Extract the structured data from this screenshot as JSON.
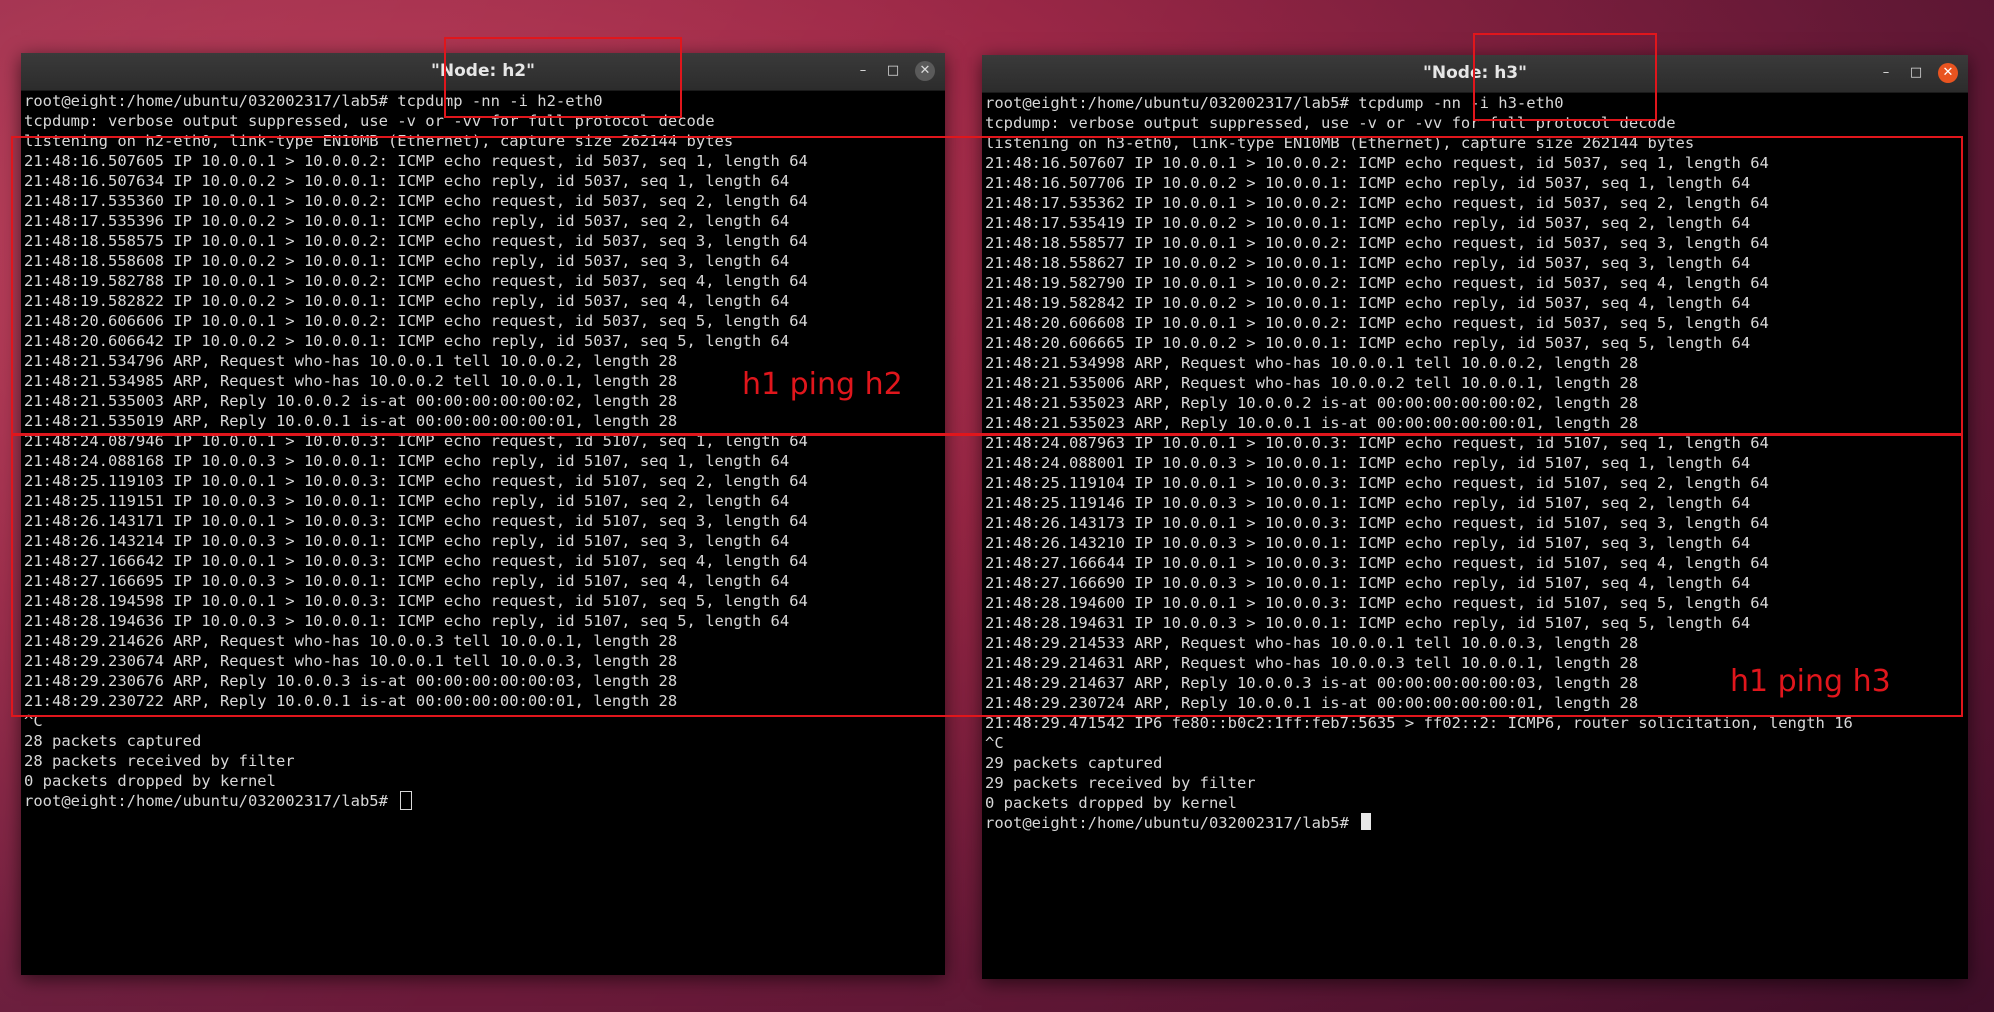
{
  "left_window": {
    "title": "\"Node: h2\"",
    "min_icon": "minimize-icon",
    "max_icon": "maximize-icon",
    "close_icon": "close-icon",
    "lines": [
      "root@eight:/home/ubuntu/032002317/lab5# tcpdump -nn -i h2-eth0",
      "tcpdump: verbose output suppressed, use -v or -vv for full protocol decode",
      "listening on h2-eth0, link-type EN10MB (Ethernet), capture size 262144 bytes",
      "21:48:16.507605 IP 10.0.0.1 > 10.0.0.2: ICMP echo request, id 5037, seq 1, length 64",
      "21:48:16.507634 IP 10.0.0.2 > 10.0.0.1: ICMP echo reply, id 5037, seq 1, length 64",
      "21:48:17.535360 IP 10.0.0.1 > 10.0.0.2: ICMP echo request, id 5037, seq 2, length 64",
      "21:48:17.535396 IP 10.0.0.2 > 10.0.0.1: ICMP echo reply, id 5037, seq 2, length 64",
      "21:48:18.558575 IP 10.0.0.1 > 10.0.0.2: ICMP echo request, id 5037, seq 3, length 64",
      "21:48:18.558608 IP 10.0.0.2 > 10.0.0.1: ICMP echo reply, id 5037, seq 3, length 64",
      "21:48:19.582788 IP 10.0.0.1 > 10.0.0.2: ICMP echo request, id 5037, seq 4, length 64",
      "21:48:19.582822 IP 10.0.0.2 > 10.0.0.1: ICMP echo reply, id 5037, seq 4, length 64",
      "21:48:20.606606 IP 10.0.0.1 > 10.0.0.2: ICMP echo request, id 5037, seq 5, length 64",
      "21:48:20.606642 IP 10.0.0.2 > 10.0.0.1: ICMP echo reply, id 5037, seq 5, length 64",
      "21:48:21.534796 ARP, Request who-has 10.0.0.1 tell 10.0.0.2, length 28",
      "21:48:21.534985 ARP, Request who-has 10.0.0.2 tell 10.0.0.1, length 28",
      "21:48:21.535003 ARP, Reply 10.0.0.2 is-at 00:00:00:00:00:02, length 28",
      "21:48:21.535019 ARP, Reply 10.0.0.1 is-at 00:00:00:00:00:01, length 28",
      "21:48:24.087946 IP 10.0.0.1 > 10.0.0.3: ICMP echo request, id 5107, seq 1, length 64",
      "21:48:24.088168 IP 10.0.0.3 > 10.0.0.1: ICMP echo reply, id 5107, seq 1, length 64",
      "21:48:25.119103 IP 10.0.0.1 > 10.0.0.3: ICMP echo request, id 5107, seq 2, length 64",
      "21:48:25.119151 IP 10.0.0.3 > 10.0.0.1: ICMP echo reply, id 5107, seq 2, length 64",
      "21:48:26.143171 IP 10.0.0.1 > 10.0.0.3: ICMP echo request, id 5107, seq 3, length 64",
      "21:48:26.143214 IP 10.0.0.3 > 10.0.0.1: ICMP echo reply, id 5107, seq 3, length 64",
      "21:48:27.166642 IP 10.0.0.1 > 10.0.0.3: ICMP echo request, id 5107, seq 4, length 64",
      "21:48:27.166695 IP 10.0.0.3 > 10.0.0.1: ICMP echo reply, id 5107, seq 4, length 64",
      "21:48:28.194598 IP 10.0.0.1 > 10.0.0.3: ICMP echo request, id 5107, seq 5, length 64",
      "21:48:28.194636 IP 10.0.0.3 > 10.0.0.1: ICMP echo reply, id 5107, seq 5, length 64",
      "21:48:29.214626 ARP, Request who-has 10.0.0.3 tell 10.0.0.1, length 28",
      "21:48:29.230674 ARP, Request who-has 10.0.0.1 tell 10.0.0.3, length 28",
      "21:48:29.230676 ARP, Reply 10.0.0.3 is-at 00:00:00:00:00:03, length 28",
      "21:48:29.230722 ARP, Reply 10.0.0.1 is-at 00:00:00:00:00:01, length 28",
      "^C",
      "28 packets captured",
      "28 packets received by filter",
      "0 packets dropped by kernel"
    ],
    "prompt": "root@eight:/home/ubuntu/032002317/lab5# "
  },
  "right_window": {
    "title": "\"Node: h3\"",
    "min_icon": "minimize-icon",
    "max_icon": "maximize-icon",
    "close_icon": "close-icon",
    "lines": [
      "root@eight:/home/ubuntu/032002317/lab5# tcpdump -nn -i h3-eth0",
      "tcpdump: verbose output suppressed, use -v or -vv for full protocol decode",
      "listening on h3-eth0, link-type EN10MB (Ethernet), capture size 262144 bytes",
      "21:48:16.507607 IP 10.0.0.1 > 10.0.0.2: ICMP echo request, id 5037, seq 1, length 64",
      "21:48:16.507706 IP 10.0.0.2 > 10.0.0.1: ICMP echo reply, id 5037, seq 1, length 64",
      "21:48:17.535362 IP 10.0.0.1 > 10.0.0.2: ICMP echo request, id 5037, seq 2, length 64",
      "21:48:17.535419 IP 10.0.0.2 > 10.0.0.1: ICMP echo reply, id 5037, seq 2, length 64",
      "21:48:18.558577 IP 10.0.0.1 > 10.0.0.2: ICMP echo request, id 5037, seq 3, length 64",
      "21:48:18.558627 IP 10.0.0.2 > 10.0.0.1: ICMP echo reply, id 5037, seq 3, length 64",
      "21:48:19.582790 IP 10.0.0.1 > 10.0.0.2: ICMP echo request, id 5037, seq 4, length 64",
      "21:48:19.582842 IP 10.0.0.2 > 10.0.0.1: ICMP echo reply, id 5037, seq 4, length 64",
      "21:48:20.606608 IP 10.0.0.1 > 10.0.0.2: ICMP echo request, id 5037, seq 5, length 64",
      "21:48:20.606665 IP 10.0.0.2 > 10.0.0.1: ICMP echo reply, id 5037, seq 5, length 64",
      "21:48:21.534998 ARP, Request who-has 10.0.0.1 tell 10.0.0.2, length 28",
      "21:48:21.535006 ARP, Request who-has 10.0.0.2 tell 10.0.0.1, length 28",
      "21:48:21.535023 ARP, Reply 10.0.0.2 is-at 00:00:00:00:00:02, length 28",
      "21:48:21.535023 ARP, Reply 10.0.0.1 is-at 00:00:00:00:00:01, length 28",
      "21:48:24.087963 IP 10.0.0.1 > 10.0.0.3: ICMP echo request, id 5107, seq 1, length 64",
      "21:48:24.088001 IP 10.0.0.3 > 10.0.0.1: ICMP echo reply, id 5107, seq 1, length 64",
      "21:48:25.119104 IP 10.0.0.1 > 10.0.0.3: ICMP echo request, id 5107, seq 2, length 64",
      "21:48:25.119146 IP 10.0.0.3 > 10.0.0.1: ICMP echo reply, id 5107, seq 2, length 64",
      "21:48:26.143173 IP 10.0.0.1 > 10.0.0.3: ICMP echo request, id 5107, seq 3, length 64",
      "21:48:26.143210 IP 10.0.0.3 > 10.0.0.1: ICMP echo reply, id 5107, seq 3, length 64",
      "21:48:27.166644 IP 10.0.0.1 > 10.0.0.3: ICMP echo request, id 5107, seq 4, length 64",
      "21:48:27.166690 IP 10.0.0.3 > 10.0.0.1: ICMP echo reply, id 5107, seq 4, length 64",
      "21:48:28.194600 IP 10.0.0.1 > 10.0.0.3: ICMP echo request, id 5107, seq 5, length 64",
      "21:48:28.194631 IP 10.0.0.3 > 10.0.0.1: ICMP echo reply, id 5107, seq 5, length 64",
      "21:48:29.214533 ARP, Request who-has 10.0.0.1 tell 10.0.0.3, length 28",
      "21:48:29.214631 ARP, Request who-has 10.0.0.3 tell 10.0.0.1, length 28",
      "21:48:29.214637 ARP, Reply 10.0.0.3 is-at 00:00:00:00:00:03, length 28",
      "21:48:29.230724 ARP, Reply 10.0.0.1 is-at 00:00:00:00:00:01, length 28",
      "21:48:29.471542 IP6 fe80::b0c2:1ff:feb7:5635 > ff02::2: ICMP6, router solicitation, length 16",
      "^C",
      "29 packets captured",
      "29 packets received by filter",
      "0 packets dropped by kernel"
    ],
    "prompt": "root@eight:/home/ubuntu/032002317/lab5# "
  },
  "annotations": {
    "label_h2": "h1 ping h2",
    "label_h3": "h1 ping h3",
    "color": "#e0161c"
  },
  "colors": {
    "terminal_bg": "#000000",
    "terminal_fg": "#d8d8d8",
    "titlebar_bg": "#2c2c2c",
    "close_active": "#e95420"
  }
}
